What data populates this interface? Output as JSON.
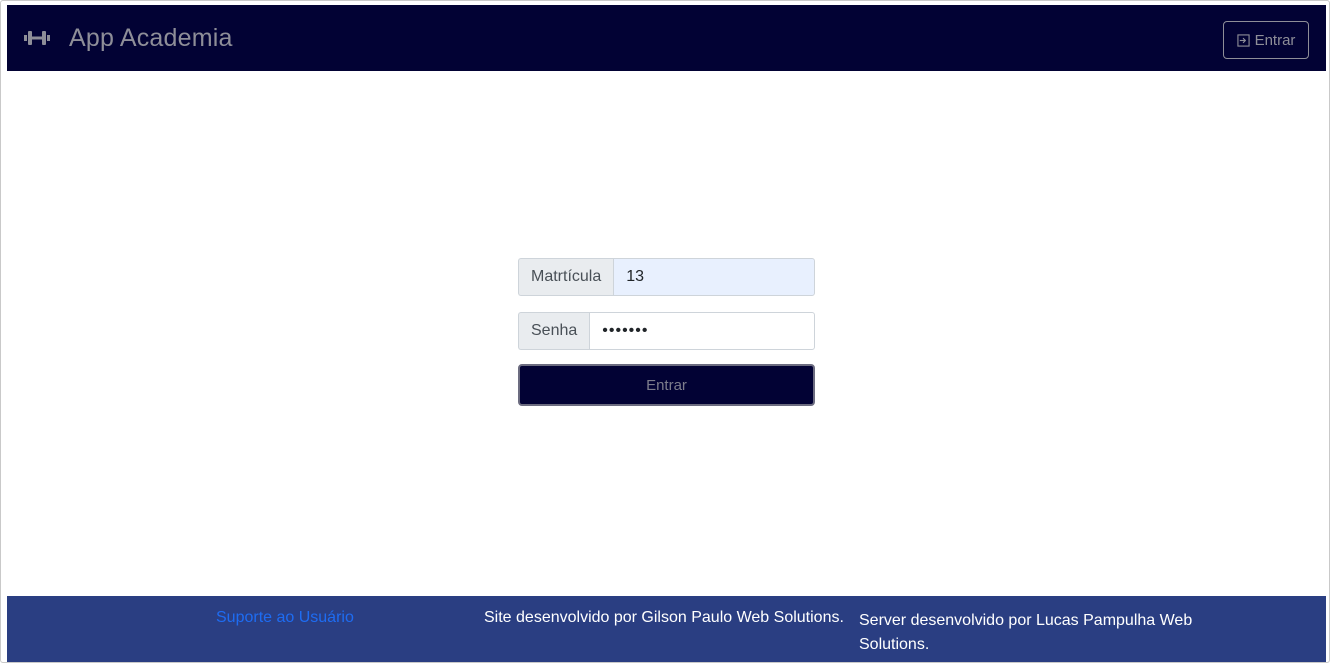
{
  "header": {
    "brand_icon": "dumbbell-icon",
    "title": "App Academia",
    "login_icon": "sign-in-icon",
    "login_label": "Entrar"
  },
  "login_form": {
    "matricula_label": "Matrtícula",
    "matricula_value": "13",
    "senha_label": "Senha",
    "senha_value": "•••••••",
    "submit_label": "Entrar"
  },
  "footer": {
    "support_link": "Suporte ao Usuário",
    "site_credit": "Site desenvolvido por Gilson Paulo Web Solutions.",
    "server_credit": "Server desenvolvido por Lucas Pampulha Web Solutions."
  },
  "colors": {
    "navbar_bg": "#020234",
    "footer_bg": "#2a3e82",
    "link": "#1e6cf2",
    "autofill_bg": "#e8f0fe"
  }
}
